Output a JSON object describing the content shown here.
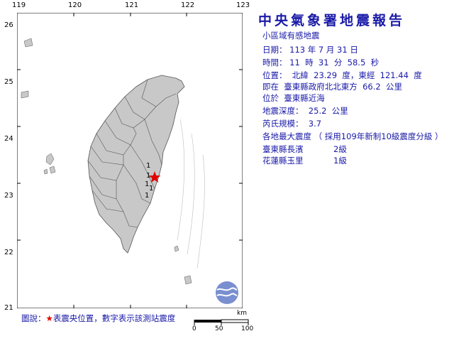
{
  "map": {
    "lon_ticks": [
      "119",
      "120",
      "121",
      "122",
      "123"
    ],
    "lat_ticks": [
      "26",
      "25",
      "24",
      "23",
      "22",
      "21"
    ],
    "epicenter_symbol": "red-star",
    "station_intensities": [
      "1",
      "1",
      "1",
      "1",
      "1"
    ],
    "colors": {
      "land": "#c8c8c8",
      "county_lines": "#555555",
      "epicenter": "#e00000",
      "text": "#1a1aa8"
    }
  },
  "report": {
    "title": "中央氣象署地震報告",
    "subtitle": "小區域有感地震",
    "date_line": "日期： 113 年 7 月 31 日",
    "time_line": "時間： 11  時  31  分  58.5  秒",
    "position_line": "位置：  北緯  23.29  度，東經  121.44  度",
    "relative_line": "即在  臺東縣政府北北東方  66.2  公里",
    "located_line": "位於  臺東縣近海",
    "depth_line": "地震深度：  25.2  公里",
    "magnitude_line": "芮氏規模：  3.7",
    "intensity_header": "各地最大震度 （ 採用109年新制10級震度分級 ）",
    "intensities": [
      {
        "location": "臺東縣長濱",
        "level": "2級"
      },
      {
        "location": "花蓮縣玉里",
        "level": "1級"
      }
    ]
  },
  "legend": {
    "prefix": "圖說：",
    "star": "★",
    "text": "表震央位置，數字表示該測站震度"
  },
  "scale": {
    "unit": "km",
    "labels": [
      "0",
      "50",
      "100"
    ]
  }
}
